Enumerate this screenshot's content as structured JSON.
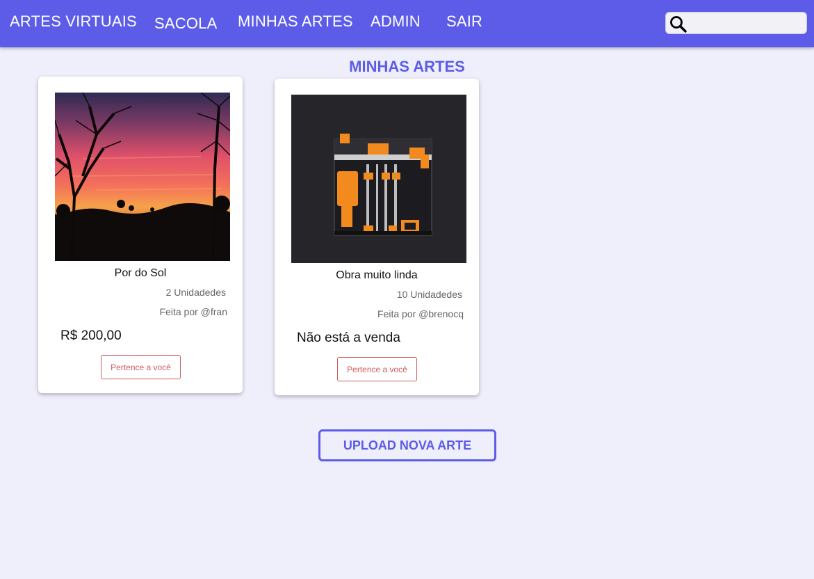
{
  "nav": {
    "brand": "ARTES VIRTUAIS",
    "bag": "SACOLA",
    "my_arts": "MINHAS ARTES",
    "admin": "ADMIN",
    "logout": "SAIR"
  },
  "search": {
    "icon": "search-icon",
    "value": "",
    "placeholder": ""
  },
  "page": {
    "title": "MINHAS ARTES"
  },
  "cards": [
    {
      "image": "sunset-photo",
      "name": "Por do Sol",
      "units": "2 Unidadedes",
      "author": "Feita por @fran",
      "price": "R$ 200,00",
      "button": "Pertence a você"
    },
    {
      "image": "3d-printer-render",
      "name": "Obra muito linda",
      "units": "10 Unidadedes",
      "author": "Feita por @brenocq",
      "price": "Não está a venda",
      "button": "Pertence a você"
    }
  ],
  "upload_button": "UPLOAD NOVA ARTE",
  "colors": {
    "accent": "#5c5ce8",
    "background": "#efeefb",
    "owned": "#d05a5a"
  }
}
